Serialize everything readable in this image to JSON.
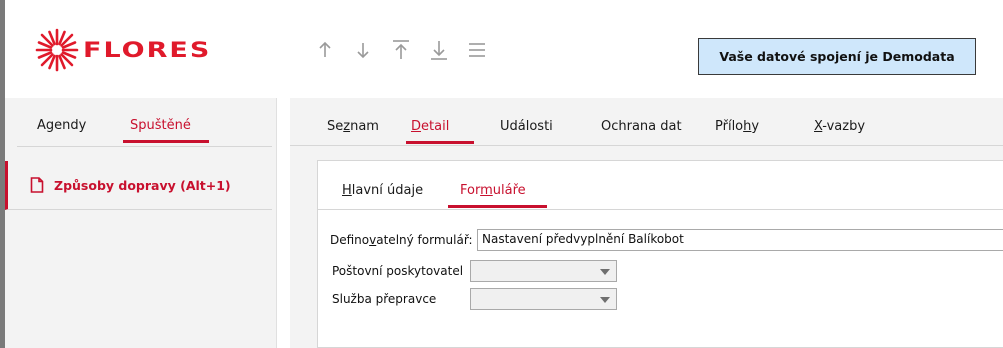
{
  "header": {
    "logo_text": "FLORES",
    "toolbar": [
      {
        "icon": "arrow-up-icon"
      },
      {
        "icon": "arrow-down-icon"
      },
      {
        "icon": "arrow-to-top-icon"
      },
      {
        "icon": "arrow-to-bottom-icon"
      },
      {
        "icon": "menu-icon"
      }
    ],
    "connection_text": "Vaše datové spojení je Demodata"
  },
  "sidebar": {
    "tabs": [
      {
        "label": "Agendy",
        "active": false
      },
      {
        "label": "Spuštěné",
        "active": true
      }
    ],
    "items": [
      {
        "label": "Způsoby dopravy (Alt+1)",
        "icon": "document-icon"
      }
    ]
  },
  "main": {
    "tabs": [
      {
        "label_pre": "Se",
        "label_u": "z",
        "label_post": "nam",
        "active": false
      },
      {
        "label_pre": "",
        "label_u": "D",
        "label_post": "etail",
        "active": true
      },
      {
        "label_pre": "Události",
        "label_u": "",
        "label_post": "",
        "active": false
      },
      {
        "label_pre": "Ochrana dat",
        "label_u": "",
        "label_post": "",
        "active": false
      },
      {
        "label_pre": "Přílo",
        "label_u": "h",
        "label_post": "y",
        "active": false
      },
      {
        "label_pre": "",
        "label_u": "X",
        "label_post": "-vazby",
        "active": false
      }
    ],
    "subtabs": [
      {
        "label_pre": "",
        "label_u": "H",
        "label_post": "lavní údaje",
        "active": false
      },
      {
        "label_pre": "For",
        "label_u": "m",
        "label_post": "uláře",
        "active": true
      }
    ],
    "form": {
      "definable_form_label_pre": "Defino",
      "definable_form_label_u": "v",
      "definable_form_label_post": "atelný formulář:",
      "definable_form_value": "Nastavení předvyplnění Balíkobot",
      "postal_provider_label": "Poštovní poskytovatel",
      "postal_provider_value": "",
      "carrier_service_label": "Služba přepravce",
      "carrier_service_value": ""
    }
  },
  "colors": {
    "accent": "#c8102e",
    "connection_bg": "#cfe7fb",
    "panel_bg": "#f3f3f3"
  }
}
